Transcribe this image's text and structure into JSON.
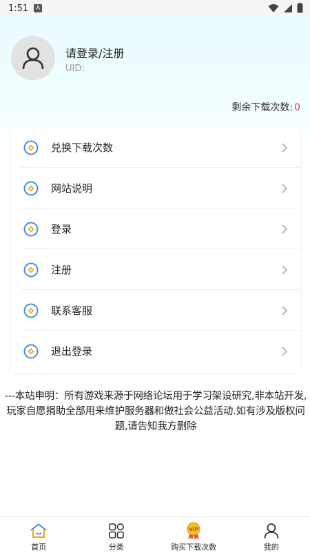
{
  "status_bar": {
    "time": "1:51",
    "app_icon": "A"
  },
  "profile": {
    "login_prompt": "请登录/注册",
    "uid_label": "UID:",
    "downloads_left_label": "剩余下载次数:",
    "downloads_left_value": "0"
  },
  "menu": {
    "items": [
      {
        "label": "兑换下载次数",
        "icon": "diamond-circle-icon"
      },
      {
        "label": "网站说明",
        "icon": "diamond-circle-icon"
      },
      {
        "label": "登录",
        "icon": "diamond-circle-icon"
      },
      {
        "label": "注册",
        "icon": "diamond-circle-icon"
      },
      {
        "label": "联系客服",
        "icon": "diamond-circle-icon"
      },
      {
        "label": "退出登录",
        "icon": "diamond-circle-icon"
      }
    ]
  },
  "notice": {
    "text": "---本站申明：所有游戏来源于网络论坛用于学习架设研究,非本站开发,玩家自愿捐助全部用来维护服务器和做社会公益活动.如有涉及版权问题,请告知我方删除"
  },
  "tabbar": {
    "tabs": [
      {
        "label": "首页",
        "icon": "home-icon"
      },
      {
        "label": "分类",
        "icon": "category-grid-icon"
      },
      {
        "label": "购买下载次数",
        "icon": "vip-medal-icon"
      },
      {
        "label": "我的",
        "icon": "user-icon"
      }
    ]
  },
  "colors": {
    "accent": "#3f8fe0",
    "icon_orange": "#f0a51e",
    "count_red": "#e03a3a"
  }
}
